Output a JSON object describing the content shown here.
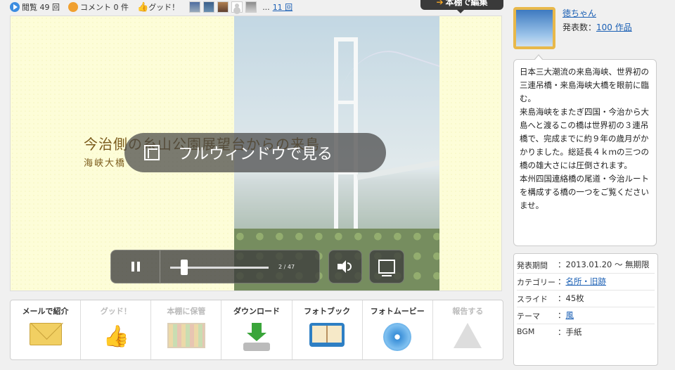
{
  "stats": {
    "views_label": "閲覧",
    "views_count": "49",
    "views_unit": "回",
    "comments_label": "コメント",
    "comments_count": "0",
    "comments_unit": "件",
    "good_label": "グッド！",
    "more": "...",
    "good_count_link": "11 回"
  },
  "edit_tag": {
    "label": "本棚で編集"
  },
  "slide": {
    "caption_line1": "今治側の糸山公園展望台からの来島",
    "caption_line2": "海峡大橋",
    "fullwindow_label": "フルウィンドウで見る",
    "counter": "2 / 47",
    "progress": 0.04
  },
  "actions": [
    {
      "label": "メールで紹介",
      "icon": "mail-icon",
      "enabled": true
    },
    {
      "label": "グッド！",
      "icon": "thumbs-up-icon",
      "enabled": false
    },
    {
      "label": "本棚に保管",
      "icon": "bookshelf-icon",
      "enabled": false
    },
    {
      "label": "ダウンロード",
      "icon": "download-icon",
      "enabled": true
    },
    {
      "label": "フォトブック",
      "icon": "photobook-icon",
      "enabled": true
    },
    {
      "label": "フォトムービー",
      "icon": "disc-icon",
      "enabled": true
    },
    {
      "label": "報告する",
      "icon": "warning-icon",
      "enabled": false
    }
  ],
  "profile": {
    "username": "徳ちゃん",
    "works_label": "発表数：",
    "works_link": "100 作品"
  },
  "description": [
    "日本三大潮流の来島海峡、世界初の三連吊橋・来島海峡大橋を眼前に臨む。",
    "来島海峡をまたぎ四国・今治から大島へと渡るこの橋は世界初の３連吊橋で、完成までに約９年の歳月がかかりました。総延長４ｋｍの三つの橋の雄大さには圧倒されます。",
    "本州四国連絡橋の尾道・今治ルートを構成する橋の一つをご覧くださいませ。"
  ],
  "info": {
    "period_label": "発表期間",
    "period_value": "：2013.01.20 ～ 無期限",
    "category_label": "カテゴリー",
    "category_sep": "：",
    "category_link": "名所・旧跡",
    "slides_label": "スライド",
    "slides_value": "：45枚",
    "theme_label": "テーマ",
    "theme_sep": "：",
    "theme_link": "風",
    "bgm_label": "BGM",
    "bgm_value": "：手紙"
  }
}
